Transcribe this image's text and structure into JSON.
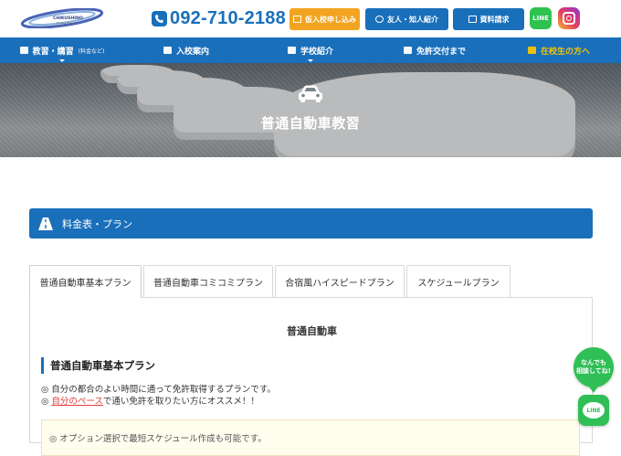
{
  "header": {
    "logo_text": "CHIKUSHINO Driving school",
    "phone_icon": "phone-icon",
    "phone": "092-710-2188",
    "buttons": [
      {
        "label": "仮入校申し込み",
        "icon": "pencil-icon",
        "color": "#f2a421"
      },
      {
        "label": "友人・知人紹介",
        "icon": "chat-icon",
        "color": "#1a6fba"
      },
      {
        "label": "資料請求",
        "icon": "mail-icon",
        "color": "#1a6fba"
      }
    ],
    "line_label": "LINE",
    "instagram_icon": "instagram-icon"
  },
  "nav": {
    "items": [
      {
        "label": "教習・講習",
        "sub": "(料金など)",
        "icon": "card-icon"
      },
      {
        "label": "入校案内",
        "icon": "document-icon"
      },
      {
        "label": "学校紹介",
        "icon": "camera-icon"
      },
      {
        "label": "免許交付まで",
        "icon": "id-card-icon"
      },
      {
        "label": "在校生の方へ",
        "icon": "book-icon"
      }
    ]
  },
  "hero": {
    "icon": "car-icon",
    "title": "普通自動車教習"
  },
  "section": {
    "icon": "road-icon",
    "title": "料金表・プラン"
  },
  "tabs": [
    {
      "label": "普通自動車基本プラン",
      "active": true
    },
    {
      "label": "普通自動車コミコミプラン",
      "active": false
    },
    {
      "label": "合宿風ハイスピードプラン",
      "active": false
    },
    {
      "label": "スケジュールプラン",
      "active": false
    }
  ],
  "panel": {
    "title": "普通自動車",
    "plan_heading": "普通自動車基本プラン",
    "line1": "◎ 自分の都合のよい時間に通って免許取得するプランです。",
    "line2_prefix": "◎ ",
    "line2_highlight": "自分のペース",
    "line2_suffix": "で通い免許を取りたい方にオススメ！！",
    "note": "◎ オプション選択で最短スケジュール作成も可能です。"
  },
  "floating": {
    "bubble_line1": "なんでも",
    "bubble_line2": "相談してね!",
    "line_label": "LINE"
  },
  "colors": {
    "brand_blue": "#1a6fba",
    "orange": "#f2a421",
    "line_green": "#2fbf56",
    "nav_active": "#f5c400",
    "highlight_red": "#e53d3d"
  }
}
